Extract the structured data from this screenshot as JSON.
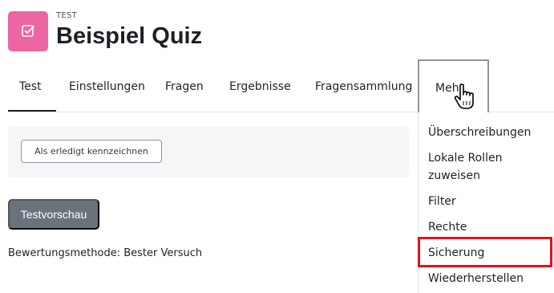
{
  "header": {
    "kicker": "TEST",
    "title": "Beispiel Quiz",
    "icon_color": "#eb66a2"
  },
  "nav": {
    "tabs": [
      {
        "label": "Test",
        "active": true
      },
      {
        "label": "Einstellungen"
      },
      {
        "label": "Fragen"
      },
      {
        "label": "Ergebnisse"
      },
      {
        "label": "Fragensammlung"
      }
    ],
    "more_label": "Mehr"
  },
  "completion": {
    "button_label": "Als erledigt kennzeichnen"
  },
  "preview_button": "Testvorschau",
  "grading_method": "Bewertungsmethode: Bester Versuch",
  "more_menu": {
    "items": [
      {
        "label": "Überschreibungen"
      },
      {
        "label": "Lokale Rollen\nzuweisen"
      },
      {
        "label": "Filter"
      },
      {
        "label": "Rechte"
      },
      {
        "label": "Sicherung",
        "highlighted": true
      },
      {
        "label": "Wiederherstellen"
      }
    ]
  },
  "highlight_color": "#e0141e"
}
